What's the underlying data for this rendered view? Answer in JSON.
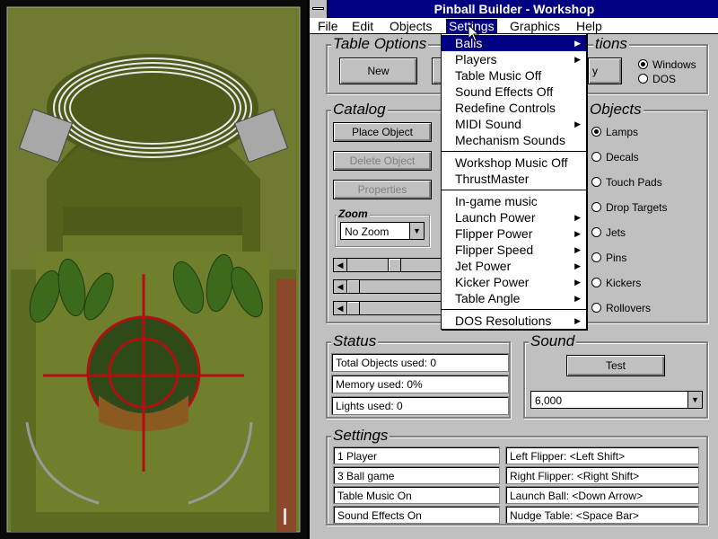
{
  "window": {
    "title": "Pinball Builder - Workshop"
  },
  "menubar": {
    "items": [
      "File",
      "Edit",
      "Objects",
      "Settings",
      "Graphics",
      "Help"
    ]
  },
  "table_options": {
    "title": "Table Options",
    "new_label": "New",
    "radio_windows": "Windows",
    "radio_dos": "DOS",
    "title_fragment": "tions",
    "fragment_y": "y"
  },
  "catalog": {
    "title": "Catalog",
    "place_object": "Place Object",
    "delete_object": "Delete Object",
    "properties": "Properties",
    "zoom_label": "Zoom",
    "zoom_value": "No Zoom"
  },
  "objects": {
    "title_fragment": "Objects",
    "items": [
      "Lamps",
      "Decals",
      "Touch Pads",
      "Drop Targets",
      "Jets",
      "Pins",
      "Kickers",
      "Rollovers"
    ],
    "selected": "Lamps"
  },
  "status": {
    "title": "Status",
    "total_objects": "Total Objects used: 0",
    "memory": "Memory used: 0%",
    "lights": "Lights used: 0"
  },
  "sound": {
    "title": "Sound",
    "test_label": "Test",
    "rate_value": "6,000"
  },
  "settings_panel": {
    "title": "Settings",
    "left_col": [
      "1 Player",
      "3 Ball game",
      "Table Music On",
      "Sound Effects On"
    ],
    "right_col": [
      "Left Flipper:  <Left Shift>",
      "Right Flipper:  <Right Shift>",
      "Launch Ball:  <Down Arrow>",
      "Nudge Table:  <Space Bar>"
    ]
  },
  "settings_menu": {
    "items": [
      {
        "label": "Balls",
        "submenu": true,
        "highlight": true
      },
      {
        "label": "Players",
        "submenu": true
      },
      {
        "label": "Table Music Off",
        "submenu": false
      },
      {
        "label": "Sound Effects Off",
        "submenu": false
      },
      {
        "label": "Redefine Controls",
        "submenu": false
      },
      {
        "label": "MIDI Sound",
        "submenu": true
      },
      {
        "label": "Mechanism Sounds",
        "submenu": false
      },
      {
        "label": "Workshop Music Off",
        "submenu": false
      },
      {
        "label": "ThrustMaster",
        "submenu": false
      },
      {
        "label": "In-game music",
        "submenu": false
      },
      {
        "label": "Launch Power",
        "submenu": true
      },
      {
        "label": "Flipper Power",
        "submenu": true
      },
      {
        "label": "Flipper Speed",
        "submenu": true
      },
      {
        "label": "Jet Power",
        "submenu": true
      },
      {
        "label": "Kicker Power",
        "submenu": true
      },
      {
        "label": "Table Angle",
        "submenu": true
      },
      {
        "label": "DOS Resolutions",
        "submenu": true
      }
    ]
  },
  "colors": {
    "titlebar": "#000080",
    "face": "#c0c0c0",
    "playfield": "#5a6a1e"
  }
}
